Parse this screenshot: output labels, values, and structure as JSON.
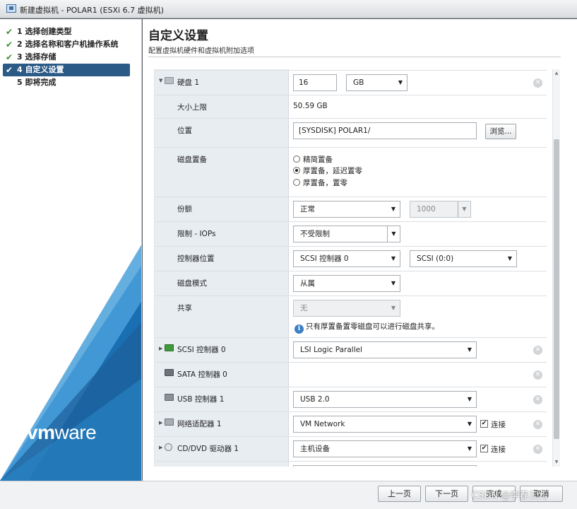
{
  "window": {
    "title": "新建虚拟机 - POLAR1 (ESXi 6.7 虚拟机)",
    "icon": "vm-window-icon"
  },
  "steps": [
    {
      "label": "1 选择创建类型",
      "checked": true
    },
    {
      "label": "2 选择名称和客户机操作系统",
      "checked": true
    },
    {
      "label": "3 选择存储",
      "checked": true
    },
    {
      "label": "4 自定义设置",
      "checked": true,
      "active": true
    },
    {
      "label": "5 即将完成",
      "checked": false
    }
  ],
  "brand": {
    "vm": "vm",
    "ware": "ware",
    "colors": {
      "blue_dark": "#1a6fb3",
      "blue_light": "#4aa0db"
    }
  },
  "page": {
    "title": "自定义设置",
    "subtitle": "配置虚拟机硬件和虚拟机附加选项"
  },
  "disk": {
    "label": "硬盘 1",
    "size_value": "16",
    "size_unit": "GB",
    "max_size_label": "大小上限",
    "max_size_value": "50.59 GB",
    "location_label": "位置",
    "location_value": "[SYSDISK] POLAR1/",
    "browse_label": "浏览...",
    "provision_label": "磁盘置备",
    "provision_options": [
      "精简置备",
      "厚置备，延迟置零",
      "厚置备，置零"
    ],
    "provision_selected": 1,
    "shares_label": "份额",
    "shares_value": "正常",
    "shares_number": "1000",
    "limit_label": "限制 - IOPs",
    "limit_value": "不受限制",
    "controller_location_label": "控制器位置",
    "controller_value": "SCSI 控制器 0",
    "controller_slot": "SCSI (0:0)",
    "mode_label": "磁盘模式",
    "mode_value": "从属",
    "sharing_label": "共享",
    "sharing_value": "无",
    "sharing_info": "只有厚置备置零磁盘可以进行磁盘共享。"
  },
  "devices": {
    "scsi": {
      "label": "SCSI 控制器 0",
      "value": "LSI Logic Parallel"
    },
    "sata": {
      "label": "SATA 控制器 0"
    },
    "usb": {
      "label": "USB 控制器 1",
      "value": "USB 2.0"
    },
    "network": {
      "label": "网络适配器 1",
      "value": "VM Network",
      "connect_label": "连接",
      "connected": true
    },
    "cddvd": {
      "label": "CD/DVD 驱动器 1",
      "value": "主机设备",
      "connect_label": "连接",
      "connected": true
    }
  },
  "footer": {
    "back": "上一页",
    "next": "下一页",
    "finish": "完成",
    "cancel": "取消"
  },
  "watermark": "CSDN @李春三九"
}
